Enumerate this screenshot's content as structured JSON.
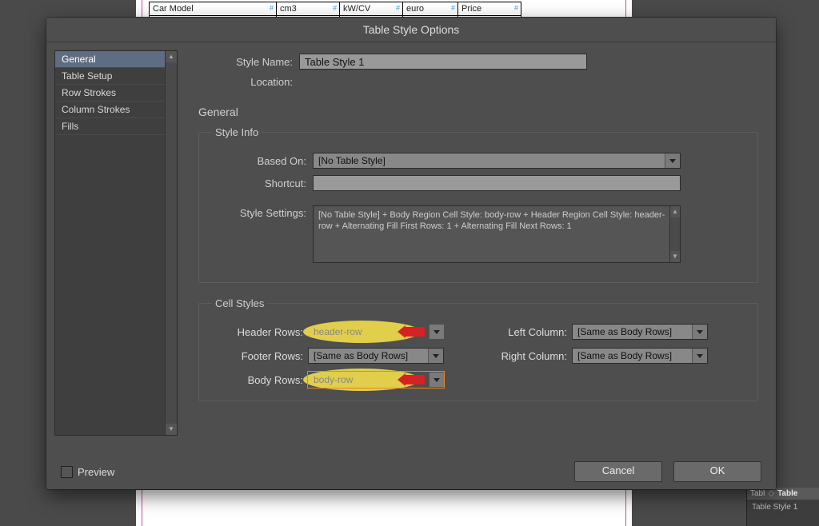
{
  "backdrop": {
    "table_headers": [
      "Car Model",
      "cm3",
      "kW/CV",
      "euro",
      "Price"
    ]
  },
  "panels": {
    "tab1": "Tabl",
    "tab2": "Table",
    "entry": "Table Style 1"
  },
  "dialog": {
    "title": "Table Style Options",
    "sidebar": {
      "items": [
        "General",
        "Table Setup",
        "Row Strokes",
        "Column Strokes",
        "Fills"
      ],
      "selected_index": 0
    },
    "style_name_label": "Style Name:",
    "style_name_value": "Table Style 1",
    "location_label": "Location:",
    "section_heading": "General",
    "style_info": {
      "legend": "Style Info",
      "based_on_label": "Based On:",
      "based_on_value": "[No Table Style]",
      "shortcut_label": "Shortcut:",
      "shortcut_value": "",
      "settings_label": "Style Settings:",
      "settings_value": "[No Table Style] + Body Region Cell Style: body-row + Header Region Cell Style: header-row + Alternating Fill First Rows: 1 + Alternating Fill Next Rows: 1"
    },
    "cell_styles": {
      "legend": "Cell Styles",
      "header_rows_label": "Header Rows:",
      "header_rows_value": "header-row",
      "footer_rows_label": "Footer Rows:",
      "footer_rows_value": "[Same as Body Rows]",
      "body_rows_label": "Body Rows:",
      "body_rows_value": "body-row",
      "left_col_label": "Left Column:",
      "left_col_value": "[Same as Body Rows]",
      "right_col_label": "Right Column:",
      "right_col_value": "[Same as Body Rows]"
    },
    "preview_label": "Preview",
    "cancel_label": "Cancel",
    "ok_label": "OK"
  }
}
